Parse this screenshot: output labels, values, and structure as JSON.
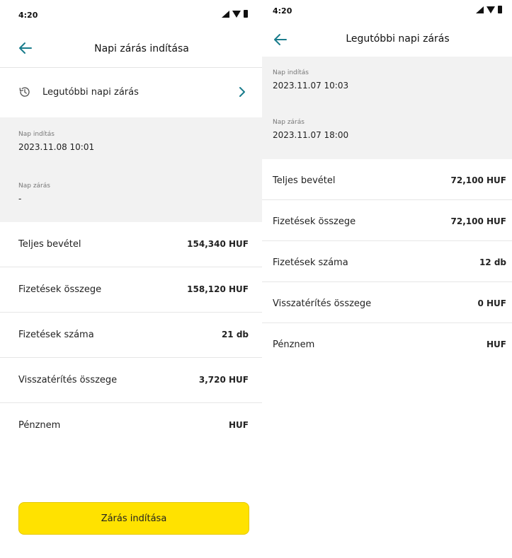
{
  "colors": {
    "accent": "#1a7c8c",
    "button": "#ffe200",
    "panel": "#f2f2f2"
  },
  "left": {
    "status": {
      "time": "4:20"
    },
    "title": "Napi zárás indítása",
    "latest_label": "Legutóbbi napi zárás",
    "fields": [
      {
        "label": "Nap indítás",
        "value": "2023.11.08 10:01"
      },
      {
        "label": "Nap zárás",
        "value": "-"
      }
    ],
    "stats": [
      {
        "label": "Teljes bevétel",
        "value": "154,340 HUF"
      },
      {
        "label": "Fizetések összege",
        "value": "158,120 HUF"
      },
      {
        "label": "Fizetések száma",
        "value": "21 db"
      },
      {
        "label": "Visszatérítés összege",
        "value": "3,720 HUF"
      },
      {
        "label": "Pénznem",
        "value": "HUF"
      }
    ],
    "button_label": "Zárás indítása"
  },
  "right": {
    "status": {
      "time": "4:20"
    },
    "title": "Legutóbbi napi zárás",
    "fields": [
      {
        "label": "Nap indítás",
        "value": "2023.11.07 10:03"
      },
      {
        "label": "Nap zárás",
        "value": "2023.11.07 18:00"
      }
    ],
    "stats": [
      {
        "label": "Teljes bevétel",
        "value": "72,100 HUF"
      },
      {
        "label": "Fizetések összege",
        "value": "72,100 HUF"
      },
      {
        "label": "Fizetések száma",
        "value": "12 db"
      },
      {
        "label": "Visszatérítés összege",
        "value": "0 HUF"
      },
      {
        "label": "Pénznem",
        "value": "HUF"
      }
    ]
  }
}
